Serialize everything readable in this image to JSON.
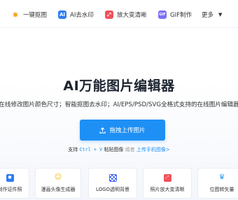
{
  "nav": {
    "items": [
      {
        "label": "一键抠图",
        "icon": "magic-star-icon",
        "color": "#f5a623"
      },
      {
        "label": "AI去水印",
        "icon": "ai-watermark-icon",
        "color": "#2f7cf6"
      },
      {
        "label": "放大变清晰",
        "icon": "enlarge-icon",
        "color": "#f0525a"
      },
      {
        "label": "GIF制作",
        "icon": "gif-icon",
        "color": "#7b6ef6"
      }
    ],
    "more_label": "更多"
  },
  "hero": {
    "title": "AI万能图片编辑器",
    "subtitle": "在线修改图片颜色尺寸；智能抠图去水印；AI/EPS/PSD/SVG全格式支持的在线图片编辑器",
    "upload_label": "拖拽上传图片",
    "hint_prefix": "支持",
    "hint_shortcut": "Ctrl + V",
    "hint_mid": "粘贴图像",
    "hint_or": "或者",
    "hint_link": "上传手机图像>"
  },
  "cards": [
    {
      "label": "制作证件照",
      "icon": "id-photo-icon",
      "color": "#2f7cf6"
    },
    {
      "label": "漫画头像生成器",
      "icon": "cartoon-avatar-icon",
      "color": "#f5b800"
    },
    {
      "label": "LOGO透明背景",
      "icon": "transparent-bg-icon",
      "color": "#4a6cf7"
    },
    {
      "label": "照片放大变清晰",
      "icon": "photo-enlarge-icon",
      "color": "#f0525a"
    },
    {
      "label": "位图转矢量",
      "icon": "vectorize-icon",
      "color": "#2f9cf6"
    }
  ]
}
